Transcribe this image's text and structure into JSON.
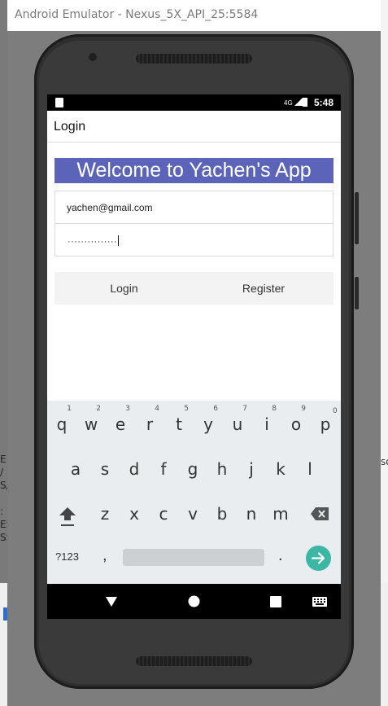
{
  "window": {
    "title": "Android Emulator - Nexus_5X_API_25:5584"
  },
  "status_bar": {
    "network": "4G",
    "time": "5:48"
  },
  "app_bar": {
    "title": "Login"
  },
  "welcome_banner": {
    "text": "Welcome to Yachen's App",
    "color": "#5b64b8"
  },
  "form": {
    "email_value": "yachen@gmail.com",
    "password_mask": "···············"
  },
  "buttons": {
    "login": "Login",
    "register": "Register"
  },
  "keyboard": {
    "row1": [
      {
        "k": "q",
        "h": ""
      },
      {
        "k": "w",
        "h": "1"
      },
      {
        "k": "e",
        "h": "2"
      },
      {
        "k": "r",
        "h": "3"
      },
      {
        "k": "t",
        "h": "4"
      },
      {
        "k": "y",
        "h": "5"
      },
      {
        "k": "u",
        "h": "6"
      },
      {
        "k": "i",
        "h": "7"
      },
      {
        "k": "o",
        "h": "8"
      },
      {
        "k": "p",
        "h": "9"
      }
    ],
    "row1_last_hint": "0",
    "row2": [
      "a",
      "s",
      "d",
      "f",
      "g",
      "h",
      "j",
      "k",
      "l"
    ],
    "row3": [
      "z",
      "x",
      "c",
      "v",
      "b",
      "n",
      "m"
    ],
    "symbols_key": "?123",
    "comma_key": ",",
    "period_key": ".",
    "enter_color": "#3cb6a5"
  }
}
